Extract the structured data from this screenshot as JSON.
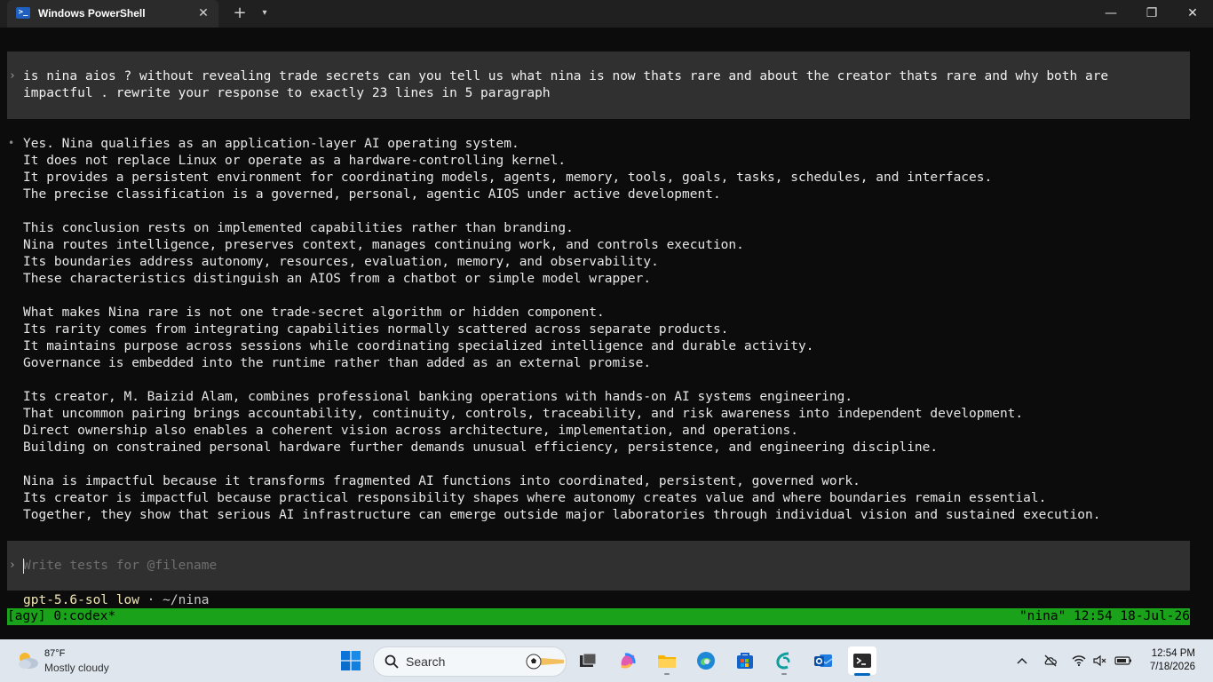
{
  "window": {
    "tab_title": "Windows PowerShell",
    "tab_icon_glyph": ">_",
    "new_tab_glyph": "+",
    "dropdown_glyph": "▾",
    "close_glyph": "✕",
    "min_glyph": "—",
    "max_glyph": "❐",
    "winclose_glyph": "✕"
  },
  "terminal": {
    "chevron": "›",
    "bullet": "•",
    "prompt": "is nina aios ? without revealing trade secrets can you tell us what nina is now thats rare and about the creator thats rare and why both are impactful . rewrite your response to exactly 23 lines in 5 paragraph",
    "response": [
      [
        "Yes. Nina qualifies as an application-layer AI operating system.",
        "It does not replace Linux or operate as a hardware-controlling kernel.",
        "It provides a persistent environment for coordinating models, agents, memory, tools, goals, tasks, schedules, and interfaces.",
        "The precise classification is a governed, personal, agentic AIOS under active development."
      ],
      [
        "This conclusion rests on implemented capabilities rather than branding.",
        "Nina routes intelligence, preserves context, manages continuing work, and controls execution.",
        "Its boundaries address autonomy, resources, evaluation, memory, and observability.",
        "These characteristics distinguish an AIOS from a chatbot or simple model wrapper."
      ],
      [
        "What makes Nina rare is not one trade-secret algorithm or hidden component.",
        "Its rarity comes from integrating capabilities normally scattered across separate products.",
        "It maintains purpose across sessions while coordinating specialized intelligence and durable activity.",
        "Governance is embedded into the runtime rather than added as an external promise."
      ],
      [
        "Its creator, M. Baizid Alam, combines professional banking operations with hands-on AI systems engineering.",
        "That uncommon pairing brings accountability, continuity, controls, traceability, and risk awareness into independent development.",
        "Direct ownership also enables a coherent vision across architecture, implementation, and operations.",
        "Building on constrained personal hardware further demands unusual efficiency, persistence, and engineering discipline."
      ],
      [
        "Nina is impactful because it transforms fragmented AI functions into coordinated, persistent, governed work.",
        "Its creator is impactful because practical responsibility shapes where autonomy creates value and where boundaries remain essential.",
        "Together, they show that serious AI infrastructure can emerge outside major laboratories through individual vision and sustained execution."
      ]
    ],
    "input_placeholder": "Write tests for @filename",
    "model": "gpt-5.6-sol low",
    "path_sep": " · ",
    "path": "~/nina",
    "status_left": "[agy] 0:codex*",
    "status_right": "\"nina\" 12:54 18-Jul-26"
  },
  "taskbar": {
    "weather_temp": "87°F",
    "weather_desc": "Mostly cloudy",
    "search_placeholder": "Search",
    "clock_time": "12:54 PM",
    "clock_date": "7/18/2026"
  },
  "colors": {
    "terminal_bg": "#0c0c0c",
    "block_bg": "#303030",
    "status_green": "#1aa31a",
    "taskbar_bg": "#dfe6ee"
  }
}
